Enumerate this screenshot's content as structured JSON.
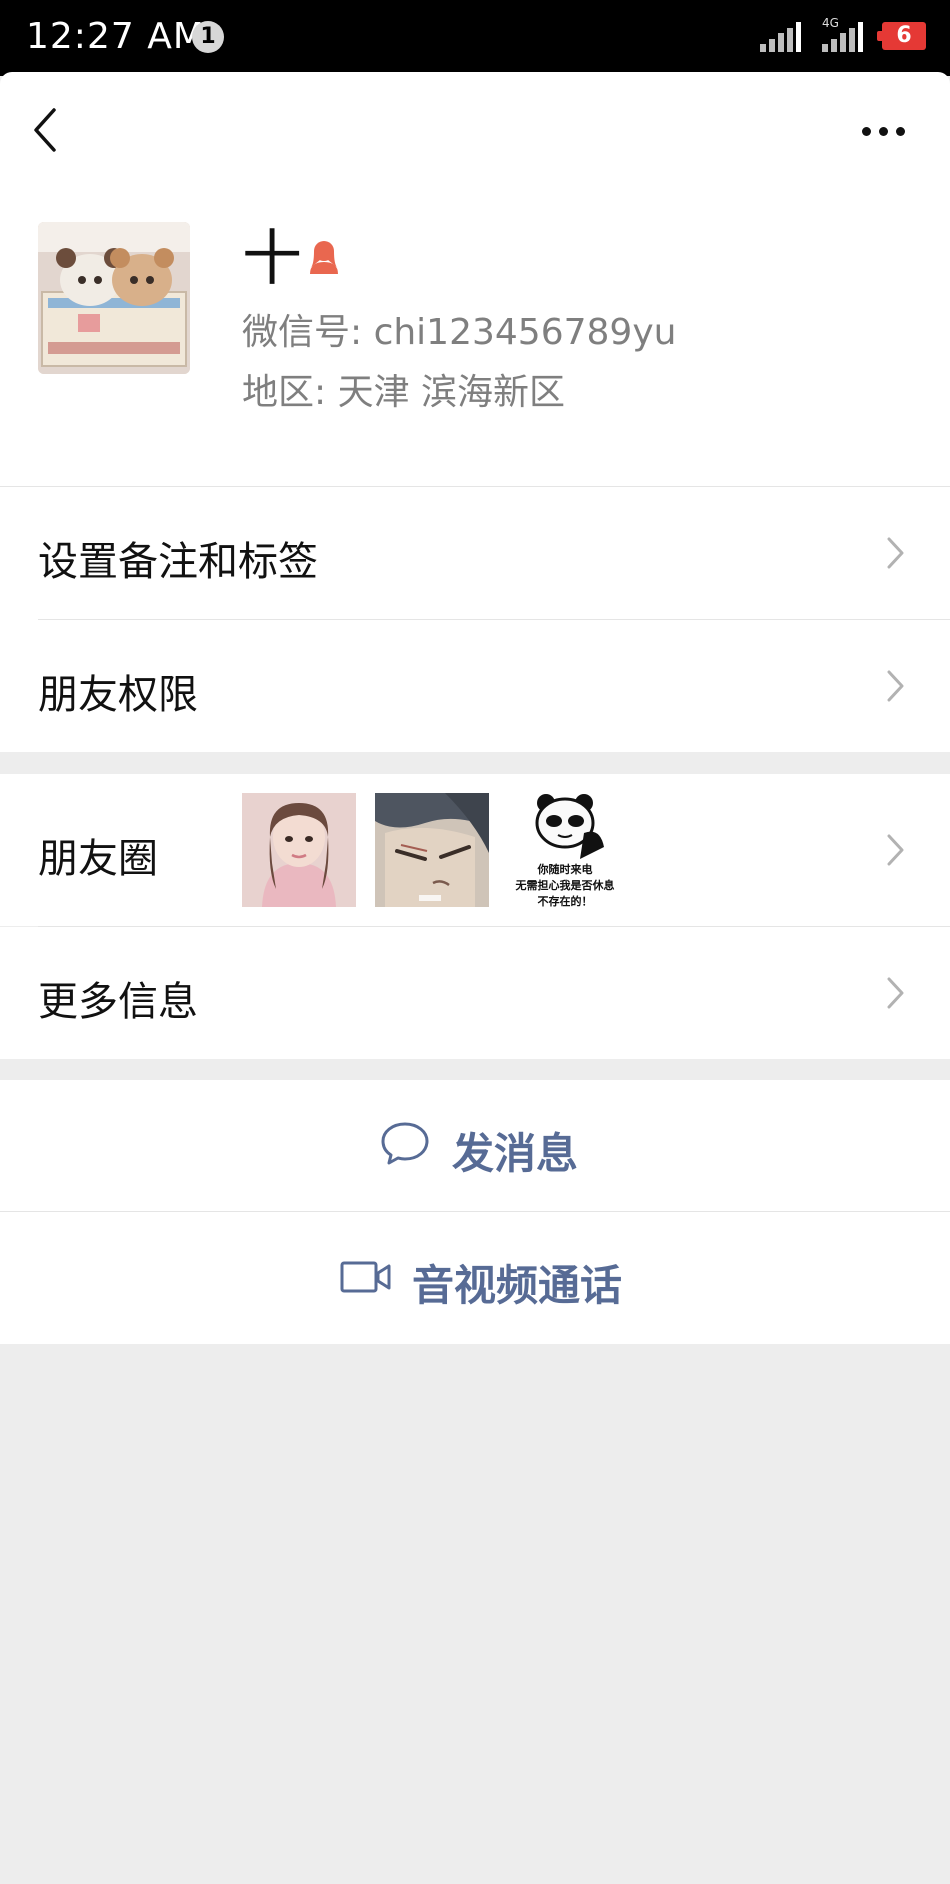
{
  "status_bar": {
    "time": "12:27 AM",
    "notification_count": "1",
    "network": "4G",
    "battery": "6"
  },
  "profile": {
    "nickname": "十",
    "wechat_id": "微信号: chi123456789yu",
    "region": "地区: 天津  滨海新区"
  },
  "menu": {
    "remark_tags": "设置备注和标签",
    "friend_permissions": "朋友权限",
    "moments": "朋友圈",
    "more_info": "更多信息"
  },
  "moments_thumbnails": [
    {
      "icon": "photo-girl"
    },
    {
      "icon": "photo-anime-man"
    },
    {
      "icon": "photo-panda-meme",
      "caption_lines": [
        "你随时来电",
        "无需担心我是否休息",
        "不存在的！"
      ]
    }
  ],
  "actions": {
    "send_message": "发消息",
    "video_call": "音视频通话"
  },
  "colors": {
    "accent_link": "#576b95",
    "gender_female": "#e9674f",
    "battery_low": "#e53935"
  }
}
